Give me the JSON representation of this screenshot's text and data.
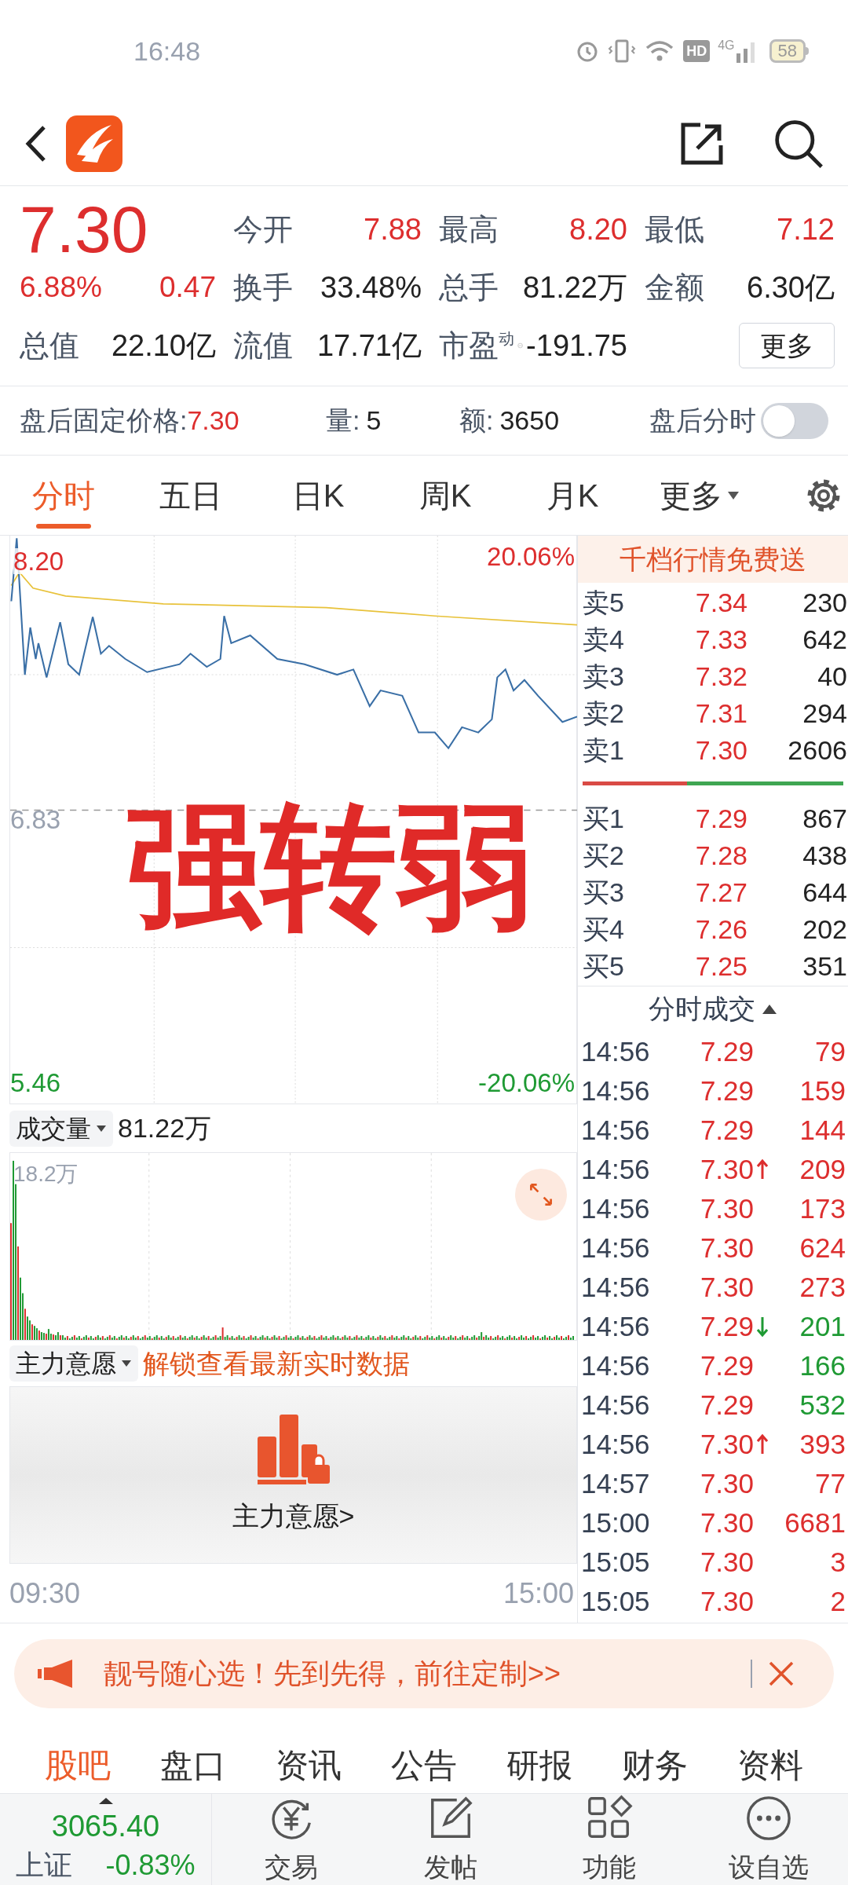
{
  "status_bar": {
    "time": "16:48",
    "hd": "HD",
    "network": "4G",
    "battery": "58"
  },
  "quote": {
    "price": "7.30",
    "change_pct": "6.88%",
    "change": "0.47",
    "stats": [
      {
        "label": "今开",
        "value": "7.88",
        "rising": true
      },
      {
        "label": "最高",
        "value": "8.20",
        "rising": true
      },
      {
        "label": "最低",
        "value": "7.12",
        "rising": true
      },
      {
        "label": "换手",
        "value": "33.48%",
        "rising": false
      },
      {
        "label": "总手",
        "value": "81.22万",
        "rising": false
      },
      {
        "label": "金额",
        "value": "6.30亿",
        "rising": false
      },
      {
        "label": "总值",
        "value": "22.10亿",
        "rising": false
      },
      {
        "label": "流值",
        "value": "17.71亿",
        "rising": false
      },
      {
        "label": "市盈",
        "sup": "动",
        "value": "-191.75",
        "rising": false
      }
    ],
    "more_button": "更多"
  },
  "after_hours": {
    "label": "盘后固定价格:",
    "price": "7.30",
    "volume_label": "量:",
    "volume": "5",
    "amount_label": "额:",
    "amount": "3650",
    "toggle_label": "盘后分时",
    "toggle_on": false
  },
  "tabs": [
    {
      "label": "分时",
      "selected": true
    },
    {
      "label": "五日",
      "selected": false
    },
    {
      "label": "日K",
      "selected": false
    },
    {
      "label": "周K",
      "selected": false
    },
    {
      "label": "月K",
      "selected": false
    },
    {
      "label": "更多",
      "selected": false
    }
  ],
  "price_chart": {
    "top_price": "8.20",
    "top_pct": "20.06%",
    "base_price": "6.83",
    "bottom_price": "5.46",
    "bottom_pct": "-20.06%",
    "overlay": "强转弱"
  },
  "volume_chart": {
    "selector": "成交量",
    "value": "81.22万",
    "axis_label": "18.2万"
  },
  "main_force": {
    "selector": "主力意愿",
    "unlock_link": "解锁查看最新实时数据",
    "locked_label": "主力意愿>"
  },
  "time_axis": [
    "09:30",
    "15:00"
  ],
  "order_book": {
    "promo": "千档行情免费送",
    "asks": [
      {
        "label": "卖5",
        "price": "7.34",
        "volume": "230"
      },
      {
        "label": "卖4",
        "price": "7.33",
        "volume": "642"
      },
      {
        "label": "卖3",
        "price": "7.32",
        "volume": "40"
      },
      {
        "label": "卖2",
        "price": "7.31",
        "volume": "294"
      },
      {
        "label": "卖1",
        "price": "7.30",
        "volume": "2606"
      }
    ],
    "bid_ask_bar": {
      "level": 0.4
    },
    "bids": [
      {
        "label": "买1",
        "price": "7.29",
        "volume": "867"
      },
      {
        "label": "买2",
        "price": "7.28",
        "volume": "438"
      },
      {
        "label": "买3",
        "price": "7.27",
        "volume": "644"
      },
      {
        "label": "买4",
        "price": "7.26",
        "volume": "202"
      },
      {
        "label": "买5",
        "price": "7.25",
        "volume": "351"
      }
    ]
  },
  "trades": {
    "title": "分时成交",
    "rows": [
      {
        "time": "14:56",
        "price": "7.29",
        "volume": "79",
        "up_arrow": false,
        "down_arrow": false,
        "sell": false
      },
      {
        "time": "14:56",
        "price": "7.29",
        "volume": "159",
        "up_arrow": false,
        "down_arrow": false,
        "sell": false
      },
      {
        "time": "14:56",
        "price": "7.29",
        "volume": "144",
        "up_arrow": false,
        "down_arrow": false,
        "sell": false
      },
      {
        "time": "14:56",
        "price": "7.30",
        "volume": "209",
        "up_arrow": true,
        "down_arrow": false,
        "sell": false
      },
      {
        "time": "14:56",
        "price": "7.30",
        "volume": "173",
        "up_arrow": false,
        "down_arrow": false,
        "sell": false
      },
      {
        "time": "14:56",
        "price": "7.30",
        "volume": "624",
        "up_arrow": false,
        "down_arrow": false,
        "sell": false
      },
      {
        "time": "14:56",
        "price": "7.30",
        "volume": "273",
        "up_arrow": false,
        "down_arrow": false,
        "sell": false
      },
      {
        "time": "14:56",
        "price": "7.29",
        "volume": "201",
        "up_arrow": false,
        "down_arrow": true,
        "sell": true
      },
      {
        "time": "14:56",
        "price": "7.29",
        "volume": "166",
        "up_arrow": false,
        "down_arrow": false,
        "sell": true
      },
      {
        "time": "14:56",
        "price": "7.29",
        "volume": "532",
        "up_arrow": false,
        "down_arrow": false,
        "sell": true
      },
      {
        "time": "14:56",
        "price": "7.30",
        "volume": "393",
        "up_arrow": true,
        "down_arrow": false,
        "sell": false
      },
      {
        "time": "14:57",
        "price": "7.30",
        "volume": "77",
        "up_arrow": false,
        "down_arrow": false,
        "sell": false
      },
      {
        "time": "15:00",
        "price": "7.30",
        "volume": "6681",
        "up_arrow": false,
        "down_arrow": false,
        "sell": false
      },
      {
        "time": "15:05",
        "price": "7.30",
        "volume": "3",
        "up_arrow": false,
        "down_arrow": false,
        "sell": false
      },
      {
        "time": "15:05",
        "price": "7.30",
        "volume": "2",
        "up_arrow": false,
        "down_arrow": false,
        "sell": false
      }
    ]
  },
  "banner": {
    "text": "靓号随心选！先到先得，前往定制>>"
  },
  "section_tabs": [
    {
      "label": "股吧",
      "selected": true
    },
    {
      "label": "盘口",
      "selected": false
    },
    {
      "label": "资讯",
      "selected": false
    },
    {
      "label": "公告",
      "selected": false
    },
    {
      "label": "研报",
      "selected": false
    },
    {
      "label": "财务",
      "selected": false
    },
    {
      "label": "资料",
      "selected": false
    }
  ],
  "bottom_nav": {
    "index": {
      "value": "3065.40",
      "name": "上证",
      "change": "-0.83%"
    },
    "items": [
      {
        "label": "交易",
        "kind": "trade"
      },
      {
        "label": "发帖",
        "kind": "post"
      },
      {
        "label": "功能",
        "kind": "features"
      },
      {
        "label": "设自选",
        "kind": "watchlist"
      }
    ]
  }
}
